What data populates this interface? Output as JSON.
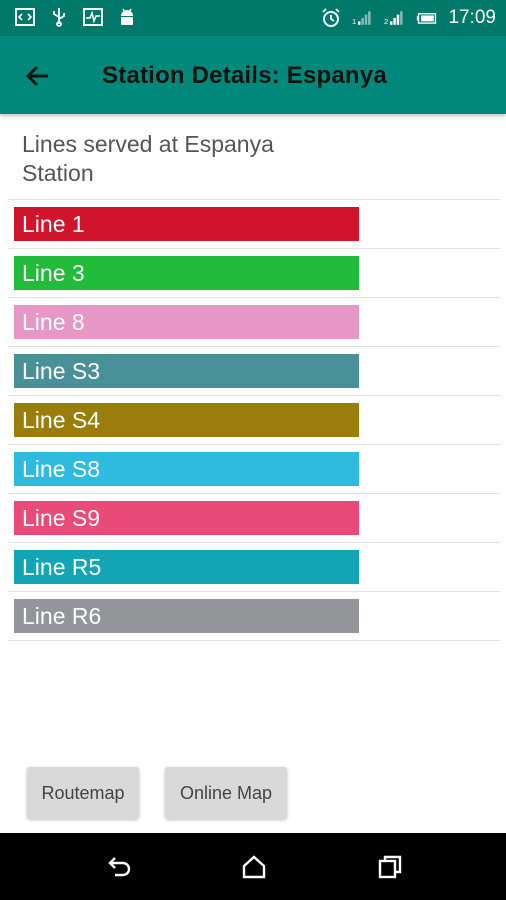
{
  "status_bar": {
    "time": "17:09",
    "left_icons": [
      "code-icon",
      "usb-icon",
      "pulse-icon",
      "android-icon"
    ],
    "right_icons": [
      "alarm-icon",
      "signal-1-icon",
      "signal-2-icon",
      "battery-icon"
    ]
  },
  "app_bar": {
    "title": "Station Details: Espanya",
    "back_icon": "arrow-back-icon",
    "background_color": "#00897b"
  },
  "content": {
    "heading": "Lines served at Espanya Station",
    "lines": [
      {
        "label": "Line 1",
        "color": "#d0142b"
      },
      {
        "label": "Line 3",
        "color": "#22bb3a"
      },
      {
        "label": "Line 8",
        "color": "#e797c5"
      },
      {
        "label": "Line S3",
        "color": "#4a9098"
      },
      {
        "label": "Line S4",
        "color": "#9a7d0a"
      },
      {
        "label": "Line S8",
        "color": "#2ebbdf"
      },
      {
        "label": "Line S9",
        "color": "#ea4a78"
      },
      {
        "label": "Line R5",
        "color": "#12a5b5"
      },
      {
        "label": "Line R6",
        "color": "#939598"
      }
    ]
  },
  "buttons": {
    "routemap": "Routemap",
    "online_map": "Online Map"
  },
  "nav_bar": {
    "icons": [
      "back-nav-icon",
      "home-icon",
      "recents-icon"
    ]
  }
}
